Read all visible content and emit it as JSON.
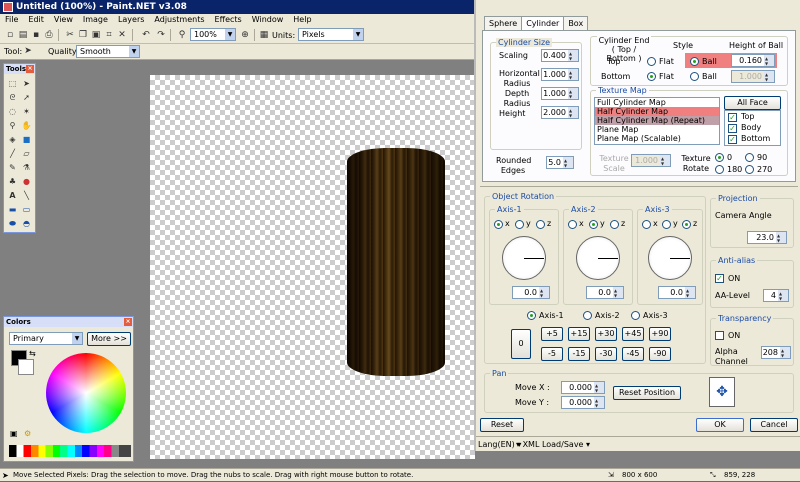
{
  "window": {
    "title": "Untitled (100%) - Paint.NET v3.08"
  },
  "menu": [
    "File",
    "Edit",
    "View",
    "Image",
    "Layers",
    "Adjustments",
    "Effects",
    "Window",
    "Help"
  ],
  "toolbar": {
    "zoom": "100%",
    "units_label": "Units:",
    "units": "Pixels"
  },
  "toolbar2": {
    "tool_label": "Tool:",
    "quality_label": "Quality:",
    "quality": "Smooth"
  },
  "tools_panel": {
    "title": "Tools"
  },
  "colors_panel": {
    "title": "Colors",
    "mode": "Primary",
    "more": "More >>"
  },
  "status": {
    "hint": "Move Selected Pixels: Drag the selection to move. Drag the nubs to scale. Drag with right mouse button to rotate.",
    "size": "800 x 600",
    "coords": "859, 228"
  },
  "dialog": {
    "tabs": [
      "Sphere",
      "Cylinder",
      "Box"
    ],
    "cyl_size": {
      "title": "Cylinder Size",
      "scaling_label": "Scaling",
      "scaling": "0.400",
      "hradius_label": "Horizontal Radius",
      "hradius": "1.000",
      "dradius_label": "Depth Radius",
      "dradius": "1.000",
      "height_label": "Height",
      "height": "2.000"
    },
    "cyl_end": {
      "title": "Cylinder End ( Top / Bottom )",
      "style_label": "Style",
      "hob_label": "Height of Ball",
      "top_label": "Top",
      "bottom_label": "Bottom",
      "flat": "Flat",
      "ball": "Ball",
      "top_value": "0.160",
      "bottom_value": "1.000"
    },
    "texture": {
      "title": "Texture Map",
      "items": [
        "Full Cylinder Map",
        "Half Cylinder Map",
        "Half Cylinder Map (Repeat)",
        "Plane Map",
        "Plane Map (Scalable)"
      ],
      "all_face": "All Face",
      "faces": [
        "Top",
        "Body",
        "Bottom"
      ],
      "scale_label": "Texture Scale",
      "scale": "1.000",
      "rotate_label": "Texture Rotate",
      "rot": [
        "0",
        "90",
        "180",
        "270"
      ]
    },
    "rounded": {
      "label": "Rounded Edges",
      "value": "5.0"
    },
    "rotation": {
      "title": "Object Rotation",
      "axes": [
        "Axis-1",
        "Axis-2",
        "Axis-3"
      ],
      "xyz": [
        "x",
        "y",
        "z"
      ],
      "values": [
        "0.0",
        "0.0",
        "0.0"
      ],
      "zero": "0",
      "steps_pos": [
        "+5",
        "+15",
        "+30",
        "+45",
        "+90"
      ],
      "steps_neg": [
        "-5",
        "-15",
        "-30",
        "-45",
        "-90"
      ]
    },
    "projection": {
      "title": "Projection",
      "angle_label": "Camera Angle",
      "angle": "23.0"
    },
    "antialias": {
      "title": "Anti-alias",
      "on": "ON",
      "level_label": "AA-Level",
      "level": "4"
    },
    "transparency": {
      "title": "Transparency",
      "on": "ON",
      "alpha_label": "Alpha Channel",
      "alpha": "208"
    },
    "pan": {
      "title": "Pan",
      "movex_label": "Move X :",
      "movex": "0.000",
      "movey_label": "Move Y :",
      "movey": "0.000",
      "reset_position": "Reset Position"
    },
    "buttons": {
      "reset": "Reset",
      "ok": "OK",
      "cancel": "Cancel"
    },
    "footer": {
      "lang": "Lang(EN)",
      "xml": "XML Load/Save"
    }
  }
}
